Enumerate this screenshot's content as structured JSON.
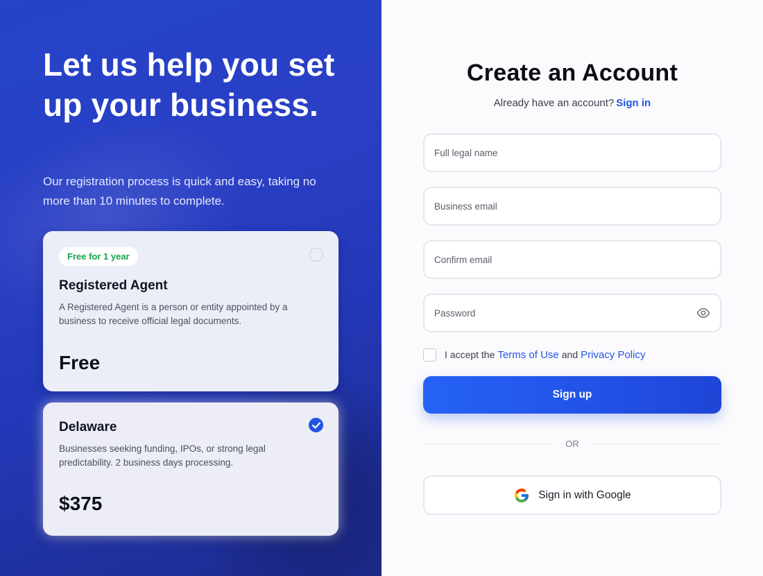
{
  "hero": {
    "headline": "Let us help you set up your business.",
    "subtext": "Our registration process is quick and easy, taking no more than 10 minutes to complete."
  },
  "plans": [
    {
      "badge": "Free for 1 year",
      "title": "Registered Agent",
      "description": "A Registered Agent is a person or entity appointed by a business to receive official legal documents.",
      "price": "Free",
      "selected": false
    },
    {
      "title": "Delaware",
      "description": "Businesses seeking funding, IPOs, or strong legal predictability. 2 business days processing.",
      "price": "$375",
      "selected": true
    }
  ],
  "form": {
    "title": "Create an Account",
    "already_text": "Already have an account?",
    "signin_link": "Sign in",
    "fields": {
      "full_name_placeholder": "Full legal name",
      "email_placeholder": "Business email",
      "confirm_email_placeholder": "Confirm email",
      "password_placeholder": "Password"
    },
    "terms": {
      "prefix": "I accept the",
      "terms_link": "Terms of Use",
      "and": "and",
      "privacy_link": "Privacy Policy"
    },
    "signup_label": "Sign up",
    "or_label": "OR",
    "google_label": "Sign in with Google"
  },
  "colors": {
    "accent": "#2454e6",
    "left_panel": "#2a3fc4",
    "badge_text": "#16a34a"
  },
  "icons": [
    "check-circle-icon",
    "radio-icon",
    "eye-icon",
    "google-icon",
    "checkbox-icon"
  ]
}
